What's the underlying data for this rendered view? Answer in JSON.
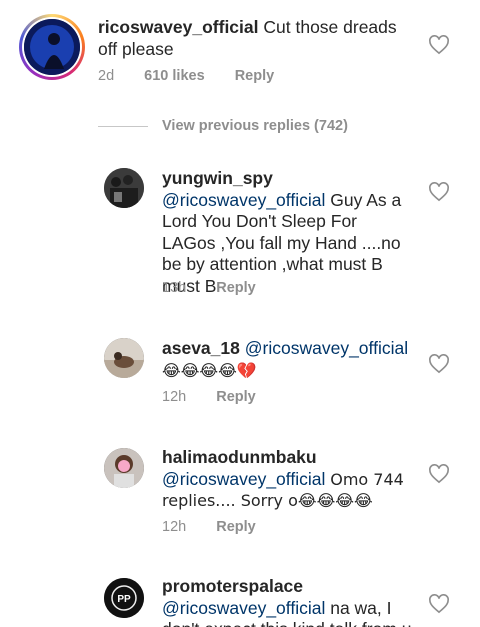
{
  "comments": [
    {
      "username": "ricoswavey_official",
      "text": "Cut those dreads off please",
      "time": "2d",
      "likes": "610 likes",
      "reply": "Reply"
    },
    {
      "username": "yungwin_spy",
      "mention": "@ricoswavey_official",
      "text": "Guy As a Lord You Don't Sleep For LAGos ,You fall my Hand ....no be by attention ,what must B must B",
      "time": "13h",
      "reply": "Reply"
    },
    {
      "username": "aseva_18",
      "mention": "@ricoswavey_official",
      "text": "😂😂😂😂💔",
      "time": "12h",
      "reply": "Reply"
    },
    {
      "username": "halimaodunmbaku",
      "mention": "@ricoswavey_official",
      "text": "Omo 744 replies.... Sorry o😂😂😂😂",
      "time": "12h",
      "reply": "Reply"
    },
    {
      "username": "promoterspalace",
      "mention": "@ricoswavey_official",
      "text": "na wa, I don't expect this kind talk from u"
    }
  ],
  "view_previous": "View previous replies (742)"
}
